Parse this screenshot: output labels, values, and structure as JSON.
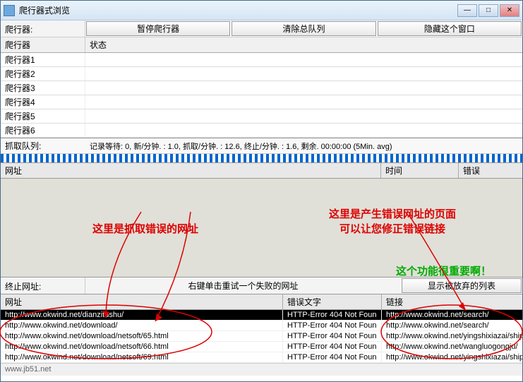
{
  "window": {
    "title": "爬行器式浏览"
  },
  "toolbar": {
    "label": "爬行器:",
    "pause": "暂停爬行器",
    "clear": "清除总队列",
    "hide": "隐藏这个窗口"
  },
  "crawler_table": {
    "col1": "爬行器",
    "col2": "状态",
    "rows": [
      "爬行器1",
      "爬行器2",
      "爬行器3",
      "爬行器4",
      "爬行器5",
      "爬行器6"
    ]
  },
  "status": {
    "label": "抓取队列:",
    "text": "记录等待:  0, 新/分钟.  :  1.0, 抓取/分钟.  :  12.6, 终止/分钟.  :  1.6, 剩余.  00:00:00 (5Min. avg)"
  },
  "mid_table": {
    "col1": "网址",
    "col2": "时间",
    "col3": "错误"
  },
  "annotations": {
    "a1": "这里是抓取错误的网址",
    "a2_line1": "这里是产生错误网址的页面",
    "a2_line2": "可以让您修正错误链接",
    "a3": "这个功能很重要啊！"
  },
  "end": {
    "label": "终止网址:",
    "mid": "右键单击重试一个失败的网址",
    "btn": "显示被放弃的列表"
  },
  "err_table": {
    "col1": "网址",
    "col2": "错误文字",
    "col3": "链接",
    "rows": [
      {
        "url": "http://www.okwind.net/dianzitushu/",
        "err": "HTTP-Error 404 Not Foun",
        "link": "http://www.okwind.net/search/"
      },
      {
        "url": "http://www.okwind.net/download/",
        "err": "HTTP-Error 404 Not Foun",
        "link": "http://www.okwind.net/search/"
      },
      {
        "url": "http://www.okwind.net/download/netsoft/65.html",
        "err": "HTTP-Error 404 Not Foun",
        "link": "http://www.okwind.net/yingshixiazai/ship"
      },
      {
        "url": "http://www.okwind.net/download/netsoft/66.html",
        "err": "HTTP-Error 404 Not Foun",
        "link": "http://www.okwind.net/wangluogongju/"
      },
      {
        "url": "http://www.okwind.net/download/netsoft/69.html",
        "err": "HTTP-Error 404 Not Foun",
        "link": "http://www.okwind.net/yingshixiazai/ship"
      }
    ]
  },
  "footer": "www.jb51.net"
}
